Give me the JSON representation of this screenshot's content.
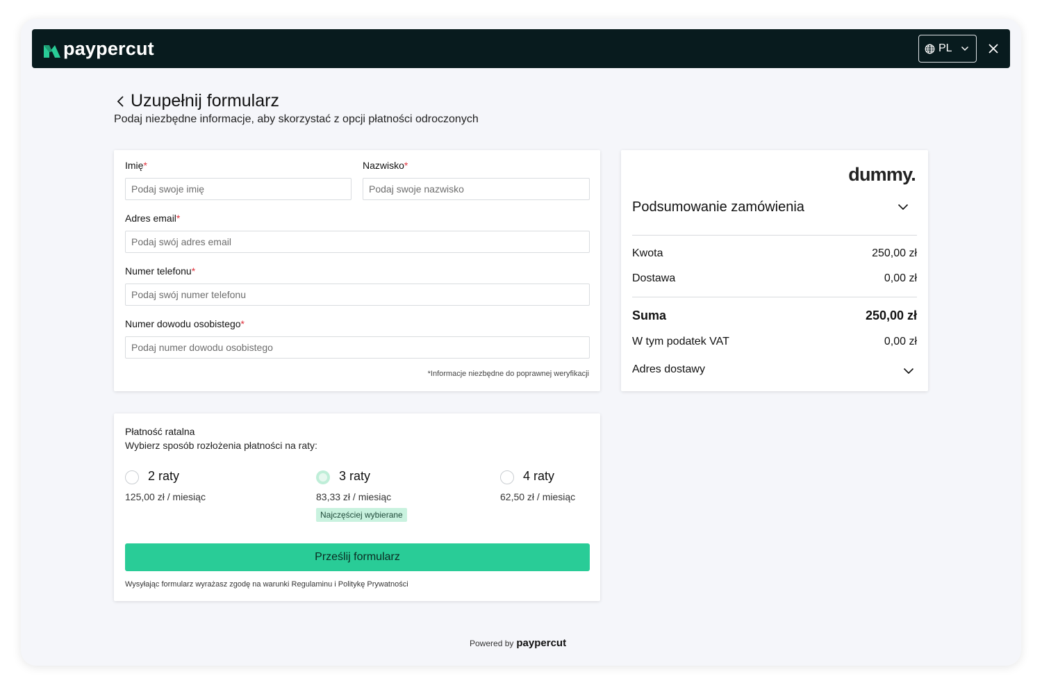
{
  "header": {
    "brand": "paypercut",
    "language": "PL"
  },
  "page": {
    "title": "Uzupełnij formularz",
    "subtitle": "Podaj niezbędne informacje, aby skorzystać z opcji płatności odroczonych"
  },
  "form": {
    "first_name": {
      "label": "Imię",
      "placeholder": "Podaj swoje imię",
      "value": ""
    },
    "last_name": {
      "label": "Nazwisko",
      "placeholder": "Podaj swoje nazwisko",
      "value": ""
    },
    "email": {
      "label": "Adres email",
      "placeholder": "Podaj swój adres email",
      "value": ""
    },
    "phone": {
      "label": "Numer telefonu",
      "placeholder": "Podaj swój numer telefonu",
      "value": ""
    },
    "id_number": {
      "label": "Numer dowodu osobistego",
      "placeholder": "Podaj numer dowodu osobistego",
      "value": ""
    },
    "required_mark": "*",
    "note": "*Informacje niezbędne do poprawnej weryfikacji"
  },
  "summary": {
    "merchant": "dummy.",
    "title": "Podsumowanie zamówienia",
    "rows": [
      {
        "label": "Kwota",
        "value": "250,00 zł"
      },
      {
        "label": "Dostawa",
        "value": "0,00 zł"
      }
    ],
    "total_label": "Suma",
    "total_value": "250,00 zł",
    "vat_label": "W tym podatek VAT",
    "vat_value": "0,00 zł",
    "address_label": "Adres dostawy"
  },
  "installments": {
    "title": "Płatność ratalna",
    "subtitle": "Wybierz sposób rozłożenia płatności na raty:",
    "options": [
      {
        "label": "2 raty",
        "price": "125,00 zł / miesiąc",
        "selected": false
      },
      {
        "label": "3 raty",
        "price": "83,33 zł / miesiąc",
        "selected": true,
        "badge": "Najczęściej wybierane"
      },
      {
        "label": "4 raty",
        "price": "62,50 zł / miesiąc",
        "selected": false
      }
    ],
    "submit_label": "Prześlij formularz",
    "consent": "Wysyłając formularz wyrażasz zgodę na warunki Regulaminu i Politykę Prywatności"
  },
  "footer": {
    "powered_by": "Powered by",
    "brand": "paypercut"
  },
  "colors": {
    "topbar": "#081b1e",
    "accent": "#29cc97",
    "required": "#e0303b",
    "badge_bg": "#c9f2df"
  }
}
